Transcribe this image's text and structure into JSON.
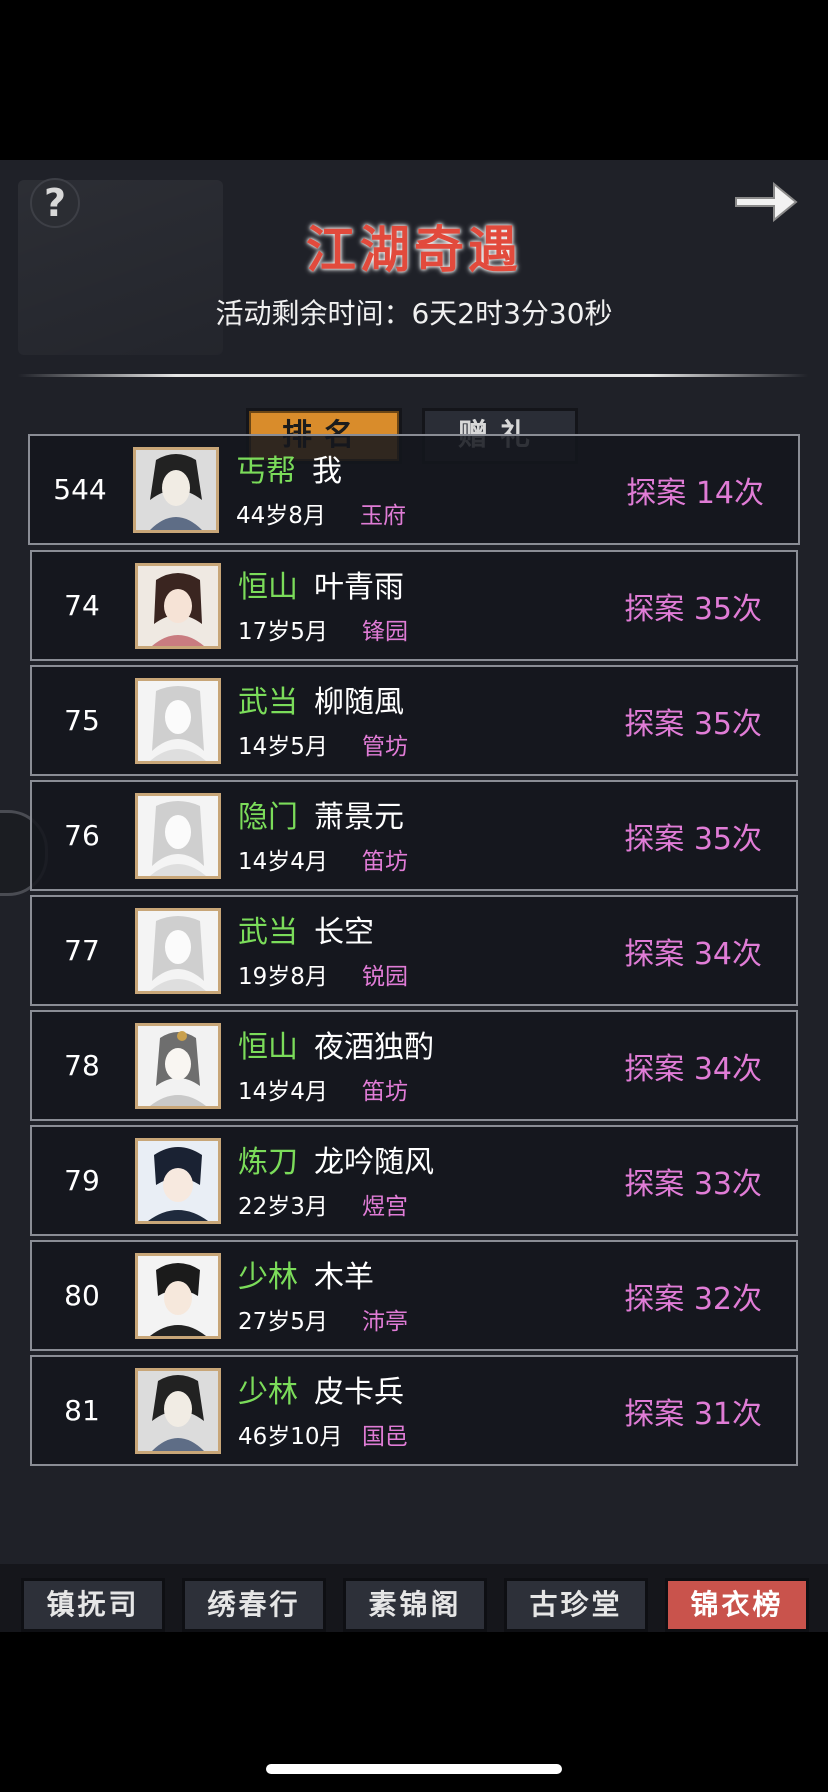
{
  "title": "江湖奇遇",
  "timer_text": "活动剩余时间：6天2时3分30秒",
  "help_label": "?",
  "tabs": {
    "ranking": "排名",
    "gift": "赠礼"
  },
  "rows": [
    {
      "rank": "544",
      "sect": "丐帮",
      "name": "我",
      "age": "44岁8月",
      "home": "玉府",
      "score": "探案 14次"
    },
    {
      "rank": "74",
      "sect": "恒山",
      "name": "叶青雨",
      "age": "17岁5月",
      "home": "锋园",
      "score": "探案 35次"
    },
    {
      "rank": "75",
      "sect": "武当",
      "name": "柳随風",
      "age": "14岁5月",
      "home": "管坊",
      "score": "探案 35次"
    },
    {
      "rank": "76",
      "sect": "隐门",
      "name": "萧景元",
      "age": "14岁4月",
      "home": "笛坊",
      "score": "探案 35次"
    },
    {
      "rank": "77",
      "sect": "武当",
      "name": "长空",
      "age": "19岁8月",
      "home": "锐园",
      "score": "探案 34次"
    },
    {
      "rank": "78",
      "sect": "恒山",
      "name": "夜酒独酌",
      "age": "14岁4月",
      "home": "笛坊",
      "score": "探案 34次"
    },
    {
      "rank": "79",
      "sect": "炼刀",
      "name": "龙吟随风",
      "age": "22岁3月",
      "home": "煜宫",
      "score": "探案 33次"
    },
    {
      "rank": "80",
      "sect": "少林",
      "name": "木羊",
      "age": "27岁5月",
      "home": "沛亭",
      "score": "探案 32次"
    },
    {
      "rank": "81",
      "sect": "少林",
      "name": "皮卡兵",
      "age": "46岁10月",
      "home": "国邑",
      "score": "探案 31次"
    }
  ],
  "bottom_nav": [
    "镇抚司",
    "绣春行",
    "素锦阁",
    "古珍堂",
    "锦衣榜"
  ],
  "colors": {
    "title": "#e24a3c",
    "sect": "#7bdc5a",
    "pink": "#e07cd6",
    "tab_active": "#d98c2b",
    "nav_active": "#c9534c"
  },
  "icons": {
    "help": "question-mark-icon",
    "exit": "arrow-right-icon"
  }
}
